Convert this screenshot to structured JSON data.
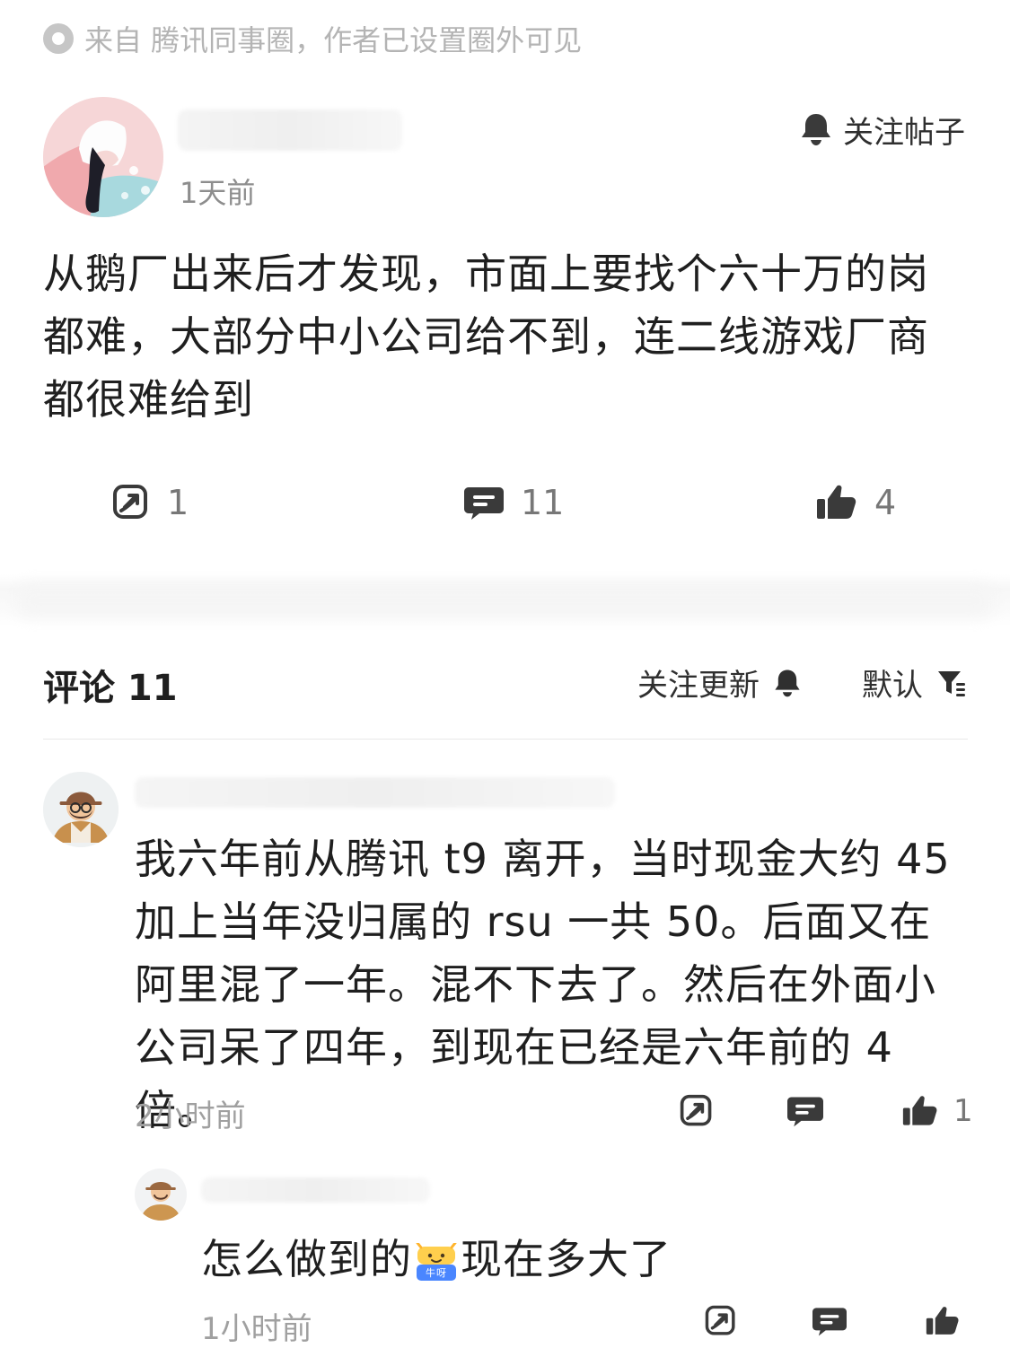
{
  "source": {
    "label": "来自 腾讯同事圈，作者已设置圈外可见",
    "icon": "location-dot-icon"
  },
  "post": {
    "time": "1天前",
    "follow_label": "关注帖子",
    "body": "从鹅厂出来后才发现，市面上要找个六十万的岗都难，大部分中小公司给不到，连二线游戏厂商都很难给到",
    "actions": {
      "share_count": "1",
      "comment_count": "11",
      "like_count": "4"
    }
  },
  "comments_header": {
    "title": "评论 11",
    "follow_updates_label": "关注更新",
    "sort_label": "默认"
  },
  "comments": [
    {
      "text": "我六年前从腾讯 t9 离开，当时现金大约 45 加上当年没归属的 rsu 一共 50。后面又在阿里混了一年。混不下去了。然后在外面小公司呆了四年，到现在已经是六年前的 4 倍。",
      "time": "2小时前",
      "like_count": "1"
    }
  ],
  "reply": {
    "text_before": "怎么做到的",
    "emoji_text": "牛呀",
    "text_after": "现在多大了",
    "time": "1小时前"
  },
  "colors": {
    "text_primary": "#1f1f1f",
    "text_secondary": "#8d8d8d",
    "text_muted": "#a0a0a0",
    "icon_dark": "#3a3a3a",
    "divider": "#e8e8e8"
  }
}
